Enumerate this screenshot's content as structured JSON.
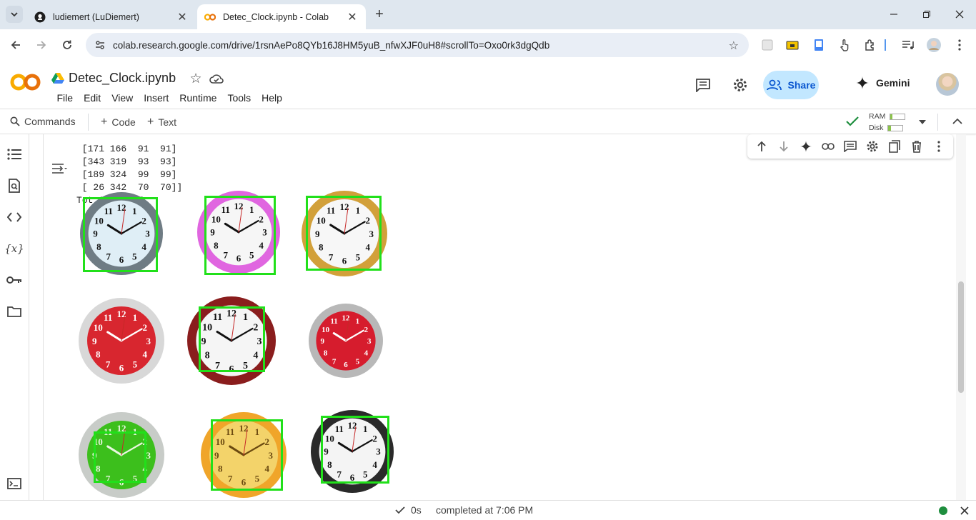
{
  "browser": {
    "tabs": [
      {
        "title": "ludiemert (LuDiemert)",
        "active": false,
        "favicon": "github-icon"
      },
      {
        "title": "Detec_Clock.ipynb - Colab",
        "active": true,
        "favicon": "colab-icon"
      }
    ],
    "url": "colab.research.google.com/drive/1rsnAePo8QYb16J8HM5yuB_nfwXJF0uH8#scrollTo=Oxo0rk3dgQdb"
  },
  "colab": {
    "notebook_title": "Detec_Clock.ipynb",
    "menu": [
      "File",
      "Edit",
      "View",
      "Insert",
      "Runtime",
      "Tools",
      "Help"
    ],
    "share_label": "Share",
    "gemini_label": "Gemini",
    "commands_label": "Commands",
    "add_code_label": "Code",
    "add_text_label": "Text",
    "ram_label": "RAM",
    "disk_label": "Disk",
    "ram_usage": 0.15,
    "disk_usage": 0.2
  },
  "cell": {
    "output_lines": [
      " [171 166  91  91]",
      " [343 319  93  93]",
      " [189 324  99  99]",
      " [ 26 342  70  70]]",
      "Tot Clock: 7"
    ]
  },
  "clocks": [
    {
      "face": "#dfeef6",
      "rim": "#6f7c84",
      "numbers": "#111",
      "detected": true
    },
    {
      "face": "#f6f6f6",
      "rim": "#e066e0",
      "numbers": "#111",
      "detected": true
    },
    {
      "face": "#f7f7f7",
      "rim": "#d2a03a",
      "numbers": "#111",
      "detected": true
    },
    {
      "face": "#d8262f",
      "rim": "#d8d8d8",
      "numbers": "#fff",
      "detected": false
    },
    {
      "face": "#f5f5f5",
      "rim": "#8a1d1d",
      "numbers": "#111",
      "detected": true
    },
    {
      "face": "#d61c2d",
      "rim": "#b8b8b8",
      "numbers": "#fff",
      "detected": false
    },
    {
      "face": "#3cbf1c",
      "rim": "#c8ccc8",
      "numbers": "#e9f7e0",
      "detected": true
    },
    {
      "face": "#f3d36a",
      "rim": "#f0a52a",
      "numbers": "#6b4a10",
      "detected": true
    },
    {
      "face": "#f4f4f4",
      "rim": "#2a2a2a",
      "numbers": "#111",
      "detected": true
    }
  ],
  "status": {
    "elapsed": "0s",
    "completed_text": "completed at 7:06 PM",
    "connected_color": "#1e8e3e"
  }
}
